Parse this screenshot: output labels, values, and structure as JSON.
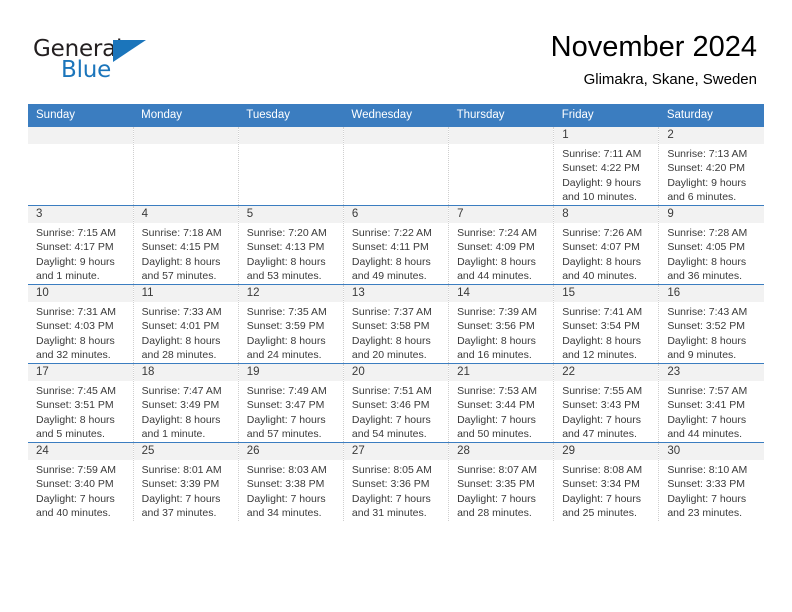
{
  "brand": {
    "name_top": "General",
    "name_bottom": "Blue",
    "accent_color": "#1b75bb",
    "logo_icon": "triangle-flag-icon"
  },
  "header": {
    "month_title": "November 2024",
    "location": "Glimakra, Skane, Sweden"
  },
  "calendar": {
    "header_bg": "#3b7dc0",
    "cell_head_bg": "#f2f2f2",
    "weekday_headers": [
      "Sunday",
      "Monday",
      "Tuesday",
      "Wednesday",
      "Thursday",
      "Friday",
      "Saturday"
    ],
    "weeks": [
      [
        {
          "day": "",
          "sunrise": "",
          "sunset": "",
          "daylight": "",
          "daylight2": ""
        },
        {
          "day": "",
          "sunrise": "",
          "sunset": "",
          "daylight": "",
          "daylight2": ""
        },
        {
          "day": "",
          "sunrise": "",
          "sunset": "",
          "daylight": "",
          "daylight2": ""
        },
        {
          "day": "",
          "sunrise": "",
          "sunset": "",
          "daylight": "",
          "daylight2": ""
        },
        {
          "day": "",
          "sunrise": "",
          "sunset": "",
          "daylight": "",
          "daylight2": ""
        },
        {
          "day": "1",
          "sunrise": "Sunrise: 7:11 AM",
          "sunset": "Sunset: 4:22 PM",
          "daylight": "Daylight: 9 hours",
          "daylight2": "and 10 minutes."
        },
        {
          "day": "2",
          "sunrise": "Sunrise: 7:13 AM",
          "sunset": "Sunset: 4:20 PM",
          "daylight": "Daylight: 9 hours",
          "daylight2": "and 6 minutes."
        }
      ],
      [
        {
          "day": "3",
          "sunrise": "Sunrise: 7:15 AM",
          "sunset": "Sunset: 4:17 PM",
          "daylight": "Daylight: 9 hours",
          "daylight2": "and 1 minute."
        },
        {
          "day": "4",
          "sunrise": "Sunrise: 7:18 AM",
          "sunset": "Sunset: 4:15 PM",
          "daylight": "Daylight: 8 hours",
          "daylight2": "and 57 minutes."
        },
        {
          "day": "5",
          "sunrise": "Sunrise: 7:20 AM",
          "sunset": "Sunset: 4:13 PM",
          "daylight": "Daylight: 8 hours",
          "daylight2": "and 53 minutes."
        },
        {
          "day": "6",
          "sunrise": "Sunrise: 7:22 AM",
          "sunset": "Sunset: 4:11 PM",
          "daylight": "Daylight: 8 hours",
          "daylight2": "and 49 minutes."
        },
        {
          "day": "7",
          "sunrise": "Sunrise: 7:24 AM",
          "sunset": "Sunset: 4:09 PM",
          "daylight": "Daylight: 8 hours",
          "daylight2": "and 44 minutes."
        },
        {
          "day": "8",
          "sunrise": "Sunrise: 7:26 AM",
          "sunset": "Sunset: 4:07 PM",
          "daylight": "Daylight: 8 hours",
          "daylight2": "and 40 minutes."
        },
        {
          "day": "9",
          "sunrise": "Sunrise: 7:28 AM",
          "sunset": "Sunset: 4:05 PM",
          "daylight": "Daylight: 8 hours",
          "daylight2": "and 36 minutes."
        }
      ],
      [
        {
          "day": "10",
          "sunrise": "Sunrise: 7:31 AM",
          "sunset": "Sunset: 4:03 PM",
          "daylight": "Daylight: 8 hours",
          "daylight2": "and 32 minutes."
        },
        {
          "day": "11",
          "sunrise": "Sunrise: 7:33 AM",
          "sunset": "Sunset: 4:01 PM",
          "daylight": "Daylight: 8 hours",
          "daylight2": "and 28 minutes."
        },
        {
          "day": "12",
          "sunrise": "Sunrise: 7:35 AM",
          "sunset": "Sunset: 3:59 PM",
          "daylight": "Daylight: 8 hours",
          "daylight2": "and 24 minutes."
        },
        {
          "day": "13",
          "sunrise": "Sunrise: 7:37 AM",
          "sunset": "Sunset: 3:58 PM",
          "daylight": "Daylight: 8 hours",
          "daylight2": "and 20 minutes."
        },
        {
          "day": "14",
          "sunrise": "Sunrise: 7:39 AM",
          "sunset": "Sunset: 3:56 PM",
          "daylight": "Daylight: 8 hours",
          "daylight2": "and 16 minutes."
        },
        {
          "day": "15",
          "sunrise": "Sunrise: 7:41 AM",
          "sunset": "Sunset: 3:54 PM",
          "daylight": "Daylight: 8 hours",
          "daylight2": "and 12 minutes."
        },
        {
          "day": "16",
          "sunrise": "Sunrise: 7:43 AM",
          "sunset": "Sunset: 3:52 PM",
          "daylight": "Daylight: 8 hours",
          "daylight2": "and 9 minutes."
        }
      ],
      [
        {
          "day": "17",
          "sunrise": "Sunrise: 7:45 AM",
          "sunset": "Sunset: 3:51 PM",
          "daylight": "Daylight: 8 hours",
          "daylight2": "and 5 minutes."
        },
        {
          "day": "18",
          "sunrise": "Sunrise: 7:47 AM",
          "sunset": "Sunset: 3:49 PM",
          "daylight": "Daylight: 8 hours",
          "daylight2": "and 1 minute."
        },
        {
          "day": "19",
          "sunrise": "Sunrise: 7:49 AM",
          "sunset": "Sunset: 3:47 PM",
          "daylight": "Daylight: 7 hours",
          "daylight2": "and 57 minutes."
        },
        {
          "day": "20",
          "sunrise": "Sunrise: 7:51 AM",
          "sunset": "Sunset: 3:46 PM",
          "daylight": "Daylight: 7 hours",
          "daylight2": "and 54 minutes."
        },
        {
          "day": "21",
          "sunrise": "Sunrise: 7:53 AM",
          "sunset": "Sunset: 3:44 PM",
          "daylight": "Daylight: 7 hours",
          "daylight2": "and 50 minutes."
        },
        {
          "day": "22",
          "sunrise": "Sunrise: 7:55 AM",
          "sunset": "Sunset: 3:43 PM",
          "daylight": "Daylight: 7 hours",
          "daylight2": "and 47 minutes."
        },
        {
          "day": "23",
          "sunrise": "Sunrise: 7:57 AM",
          "sunset": "Sunset: 3:41 PM",
          "daylight": "Daylight: 7 hours",
          "daylight2": "and 44 minutes."
        }
      ],
      [
        {
          "day": "24",
          "sunrise": "Sunrise: 7:59 AM",
          "sunset": "Sunset: 3:40 PM",
          "daylight": "Daylight: 7 hours",
          "daylight2": "and 40 minutes."
        },
        {
          "day": "25",
          "sunrise": "Sunrise: 8:01 AM",
          "sunset": "Sunset: 3:39 PM",
          "daylight": "Daylight: 7 hours",
          "daylight2": "and 37 minutes."
        },
        {
          "day": "26",
          "sunrise": "Sunrise: 8:03 AM",
          "sunset": "Sunset: 3:38 PM",
          "daylight": "Daylight: 7 hours",
          "daylight2": "and 34 minutes."
        },
        {
          "day": "27",
          "sunrise": "Sunrise: 8:05 AM",
          "sunset": "Sunset: 3:36 PM",
          "daylight": "Daylight: 7 hours",
          "daylight2": "and 31 minutes."
        },
        {
          "day": "28",
          "sunrise": "Sunrise: 8:07 AM",
          "sunset": "Sunset: 3:35 PM",
          "daylight": "Daylight: 7 hours",
          "daylight2": "and 28 minutes."
        },
        {
          "day": "29",
          "sunrise": "Sunrise: 8:08 AM",
          "sunset": "Sunset: 3:34 PM",
          "daylight": "Daylight: 7 hours",
          "daylight2": "and 25 minutes."
        },
        {
          "day": "30",
          "sunrise": "Sunrise: 8:10 AM",
          "sunset": "Sunset: 3:33 PM",
          "daylight": "Daylight: 7 hours",
          "daylight2": "and 23 minutes."
        }
      ]
    ]
  }
}
